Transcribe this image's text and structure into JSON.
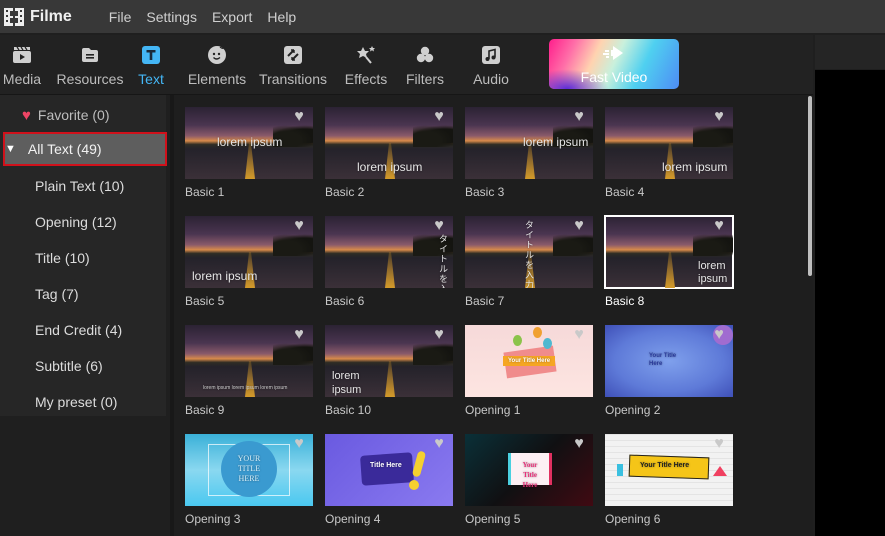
{
  "app": {
    "name": "Filme"
  },
  "menu": [
    "File",
    "Settings",
    "Export",
    "Help"
  ],
  "toolbar": {
    "tabs": [
      {
        "label": "Media",
        "icon": "media-icon"
      },
      {
        "label": "Resources",
        "icon": "resources-icon"
      },
      {
        "label": "Text",
        "icon": "text-icon",
        "active": true
      },
      {
        "label": "Elements",
        "icon": "elements-icon"
      },
      {
        "label": "Transitions",
        "icon": "transitions-icon"
      },
      {
        "label": "Effects",
        "icon": "effects-icon"
      },
      {
        "label": "Filters",
        "icon": "filters-icon"
      },
      {
        "label": "Audio",
        "icon": "audio-icon"
      }
    ],
    "fast_video": "Fast Video",
    "active_color": "#44b6f5"
  },
  "sidebar": {
    "favorite": "Favorite (0)",
    "all_text": "All Text (49)",
    "categories": [
      "Plain Text (10)",
      "Opening (12)",
      "Title (10)",
      "Tag (7)",
      "End Credit (4)",
      "Subtitle (6)",
      "My preset (0)"
    ]
  },
  "grid": {
    "items": [
      {
        "label": "Basic 1",
        "overlay": "lorem ipsum"
      },
      {
        "label": "Basic 2",
        "overlay": "lorem ipsum"
      },
      {
        "label": "Basic 3",
        "overlay": "lorem ipsum"
      },
      {
        "label": "Basic 4",
        "overlay": "lorem ipsum"
      },
      {
        "label": "Basic 5",
        "overlay": "lorem ipsum"
      },
      {
        "label": "Basic 6",
        "overlay": "タイトルを入力"
      },
      {
        "label": "Basic 7",
        "overlay": "タイトルを入力"
      },
      {
        "label": "Basic 8",
        "overlay": "lorem ipsum",
        "selected": true
      },
      {
        "label": "Basic 9",
        "overlay": "lorem ipsum lorem ipsum lorem ipsum"
      },
      {
        "label": "Basic 10",
        "overlay": "lorem ipsum"
      },
      {
        "label": "Opening 1",
        "overlay": "Your Title Here"
      },
      {
        "label": "Opening 2",
        "overlay": "Your Title Here"
      },
      {
        "label": "Opening 3",
        "overlay": "YOUR TITLE HERE"
      },
      {
        "label": "Opening 4",
        "overlay": "Title Here"
      },
      {
        "label": "Opening 5",
        "overlay": "Your Title Here"
      },
      {
        "label": "Opening 6",
        "overlay": "Your Title Here"
      }
    ]
  }
}
